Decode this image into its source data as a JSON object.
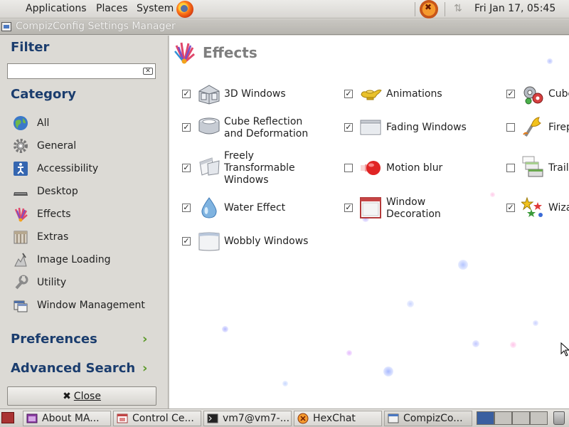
{
  "top_panel": {
    "menus": [
      "Applications",
      "Places",
      "System"
    ],
    "clock": "Fri Jan 17, 05:45"
  },
  "window": {
    "title": "CompizConfig Settings Manager"
  },
  "sidebar": {
    "filter_label": "Filter",
    "filter_value": "",
    "category_label": "Category",
    "categories": [
      {
        "label": "All",
        "icon": "globe-icon"
      },
      {
        "label": "General",
        "icon": "gear-icon"
      },
      {
        "label": "Accessibility",
        "icon": "accessibility-icon"
      },
      {
        "label": "Desktop",
        "icon": "desktop-icon"
      },
      {
        "label": "Effects",
        "icon": "effects-icon"
      },
      {
        "label": "Extras",
        "icon": "extras-icon"
      },
      {
        "label": "Image Loading",
        "icon": "image-loading-icon"
      },
      {
        "label": "Utility",
        "icon": "utility-icon"
      },
      {
        "label": "Window Management",
        "icon": "window-management-icon"
      }
    ],
    "preferences_label": "Preferences",
    "advanced_search_label": "Advanced Search",
    "close_label": "Close"
  },
  "main": {
    "title": "Effects",
    "plugins": [
      {
        "label": "3D Windows",
        "checked": true,
        "icon": "3d-windows-icon"
      },
      {
        "label": "Animations",
        "checked": true,
        "icon": "animations-icon"
      },
      {
        "label": "Cube",
        "checked": true,
        "icon": "cube-gears-icon"
      },
      {
        "label": "Cube Reflection\nand Deformation",
        "checked": true,
        "icon": "cube-reflection-icon"
      },
      {
        "label": "Fading Windows",
        "checked": true,
        "icon": "fading-windows-icon"
      },
      {
        "label": "Firep",
        "checked": false,
        "icon": "firepaint-icon"
      },
      {
        "label": "Freely\nTransformable\nWindows",
        "checked": true,
        "icon": "freely-transformable-icon"
      },
      {
        "label": "Motion blur",
        "checked": false,
        "icon": "motion-blur-icon"
      },
      {
        "label": "Trail",
        "checked": false,
        "icon": "trailfocus-icon"
      },
      {
        "label": "Water Effect",
        "checked": true,
        "icon": "water-drop-icon"
      },
      {
        "label": "Window\nDecoration",
        "checked": true,
        "icon": "window-decoration-icon"
      },
      {
        "label": "Wiza",
        "checked": true,
        "icon": "wizard-stars-icon"
      },
      {
        "label": "Wobbly Windows",
        "checked": true,
        "icon": "wobbly-windows-icon"
      }
    ]
  },
  "taskbar": {
    "tasks": [
      {
        "label": "About MA...",
        "icon": "app-icon"
      },
      {
        "label": "Control Ce...",
        "icon": "control-center-icon"
      },
      {
        "label": "vm7@vm7-...",
        "icon": "terminal-icon"
      },
      {
        "label": "HexChat",
        "icon": "hexchat-icon"
      },
      {
        "label": "CompizCo...",
        "icon": "compiz-icon"
      }
    ]
  }
}
